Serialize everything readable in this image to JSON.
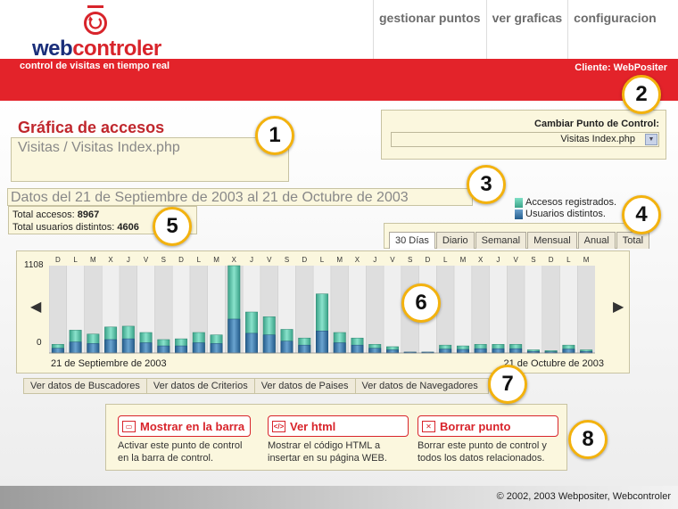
{
  "header": {
    "logo_part1": "web",
    "logo_part2": "controler",
    "tagline": "control de visitas en tiempo real",
    "client": "Cliente: WebPositer"
  },
  "nav": {
    "items": [
      "gestionar puntos",
      "ver graficas",
      "configuracion"
    ]
  },
  "page": {
    "title": "Gráfica de accesos",
    "subtitle": "Visitas / Visitas Index.php"
  },
  "control": {
    "label": "Cambiar Punto de Control:",
    "selected": "Visitas Index.php"
  },
  "range": {
    "title": "Datos del 21 de Septiembre de 2003 al 21 de Octubre de 2003",
    "total_accesses_label": "Total accesos: ",
    "total_accesses": "8967",
    "total_users_label": "Total usuarios distintos: ",
    "total_users": "4606"
  },
  "legend": {
    "accesses": "Accesos registrados.",
    "users": "Usuarios distintos."
  },
  "tabs": [
    "30 Días",
    "Diario",
    "Semanal",
    "Mensual",
    "Anual",
    "Total"
  ],
  "colors": {
    "accent": "#e3232a",
    "accesses": "#5cc2a8",
    "users": "#3b78a8"
  },
  "chart_data": {
    "type": "bar",
    "categories": [
      "D",
      "L",
      "M",
      "X",
      "J",
      "V",
      "S",
      "D",
      "L",
      "M",
      "X",
      "J",
      "V",
      "S",
      "D",
      "L",
      "M",
      "X",
      "J",
      "V",
      "S",
      "D",
      "L",
      "M",
      "X",
      "J",
      "V",
      "S",
      "D",
      "L",
      "M"
    ],
    "series": [
      {
        "name": "Accesos registrados.",
        "values": [
          110,
          290,
          240,
          330,
          340,
          260,
          170,
          180,
          260,
          230,
          1108,
          520,
          460,
          300,
          190,
          750,
          260,
          190,
          110,
          80,
          10,
          10,
          100,
          90,
          110,
          110,
          110,
          40,
          30,
          100,
          40
        ]
      },
      {
        "name": "Usuarios distintos.",
        "values": [
          60,
          140,
          120,
          170,
          180,
          130,
          90,
          90,
          130,
          120,
          430,
          250,
          230,
          150,
          100,
          280,
          130,
          100,
          60,
          40,
          5,
          5,
          50,
          45,
          55,
          55,
          55,
          20,
          15,
          50,
          20
        ]
      }
    ],
    "stacked": true,
    "ylim": [
      0,
      1108
    ],
    "y_ticks": [
      "1108",
      "0"
    ],
    "x_start_label": "21 de Septiembre de 2003",
    "x_end_label": "21 de Octubre de 2003",
    "grid": true
  },
  "data_links": [
    "Ver datos de Buscadores",
    "Ver datos de Criterios",
    "Ver datos de Paises",
    "Ver datos de Navegadores"
  ],
  "actions": [
    {
      "label": "Mostrar en la barra",
      "desc1": "Activar este punto de control",
      "desc2": "en la barra de control."
    },
    {
      "label": "Ver html",
      "desc1": "Mostrar el código HTML a",
      "desc2": "insertar en su página WEB."
    },
    {
      "label": "Borrar punto",
      "desc1": "Borrar este punto de control y",
      "desc2": "todos los datos relacionados."
    }
  ],
  "callouts": [
    "1",
    "2",
    "3",
    "4",
    "5",
    "6",
    "7",
    "8"
  ],
  "footer": {
    "copyright": "© 2002, 2003 Webpositer, Webcontroler"
  }
}
